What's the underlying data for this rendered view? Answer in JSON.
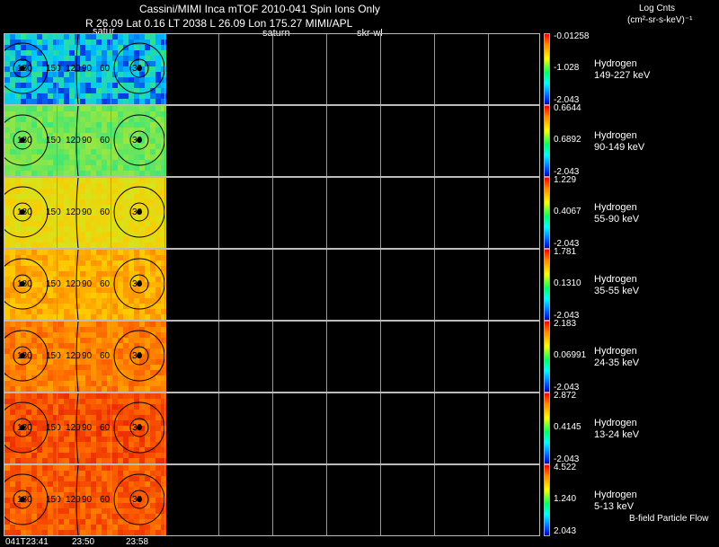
{
  "header": {
    "title": "Cassini/MIMI Inca mTOF  2010-041   Spin    Ions Only",
    "info_line": "R          26.09 Lat 0.16 LT 2038 L         26.09 Lon          175.27  MIMI/APL",
    "label_satur": "satur",
    "label_saturn": "saturn",
    "label_skr": "skr-wl",
    "units_line1": "Log Cnts",
    "units_line2": "(cm²-sr-s-keV)⁻¹"
  },
  "panels": [
    {
      "species": "Hydrogen",
      "energy": "149-227 keV",
      "max": "-0.01258",
      "mid": "-1.028",
      "min": "-2.043",
      "level": 0.15
    },
    {
      "species": "Hydrogen",
      "energy": "90-149 keV",
      "max": "0.6644",
      "mid": "0.6892",
      "min": "-2.043",
      "level": 0.42
    },
    {
      "species": "Hydrogen",
      "energy": "55-90 keV",
      "max": "1.229",
      "mid": "0.4067",
      "min": "-2.043",
      "level": 0.62
    },
    {
      "species": "Hydrogen",
      "energy": "35-55 keV",
      "max": "1.781",
      "mid": "0.1310",
      "min": "-2.043",
      "level": 0.74
    },
    {
      "species": "Hydrogen",
      "energy": "24-35 keV",
      "max": "2.183",
      "mid": "0.06991",
      "min": "-2.043",
      "level": 0.82
    },
    {
      "species": "Hydrogen",
      "energy": "13-24 keV",
      "max": "2.872",
      "mid": "0.4145",
      "min": "-2.043",
      "level": 0.9
    },
    {
      "species": "Hydrogen",
      "energy": "5-13 keV",
      "max": "4.522",
      "mid": "1.240",
      "min": "2.043",
      "level": 0.88
    }
  ],
  "angle_labels": [
    "180",
    "150",
    "120",
    "90",
    "60",
    "30"
  ],
  "footer": {
    "time1": "041T23:41",
    "time2": "23:50",
    "time3": "23:58",
    "bfield": "B-field Particle Flow"
  },
  "colors": {
    "background": "#000000",
    "grid": "#999999"
  }
}
